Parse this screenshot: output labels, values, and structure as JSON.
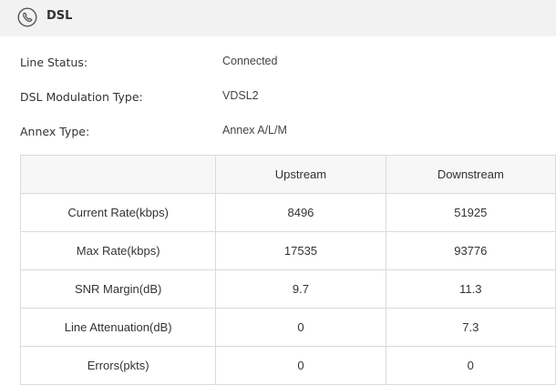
{
  "header": {
    "title": "DSL",
    "icon": "phone-icon"
  },
  "info": [
    {
      "label": "Line Status:",
      "value": "Connected"
    },
    {
      "label": "DSL Modulation Type:",
      "value": "VDSL2"
    },
    {
      "label": "Annex Type:",
      "value": "Annex A/L/M"
    }
  ],
  "table": {
    "headers": [
      "",
      "Upstream",
      "Downstream"
    ],
    "rows": [
      {
        "name": "Current Rate(kbps)",
        "up": "8496",
        "down": "51925"
      },
      {
        "name": "Max Rate(kbps)",
        "up": "17535",
        "down": "93776"
      },
      {
        "name": "SNR Margin(dB)",
        "up": "9.7",
        "down": "11.3"
      },
      {
        "name": "Line Attenuation(dB)",
        "up": "0",
        "down": "7.3"
      },
      {
        "name": "Errors(pkts)",
        "up": "0",
        "down": "0"
      }
    ]
  }
}
